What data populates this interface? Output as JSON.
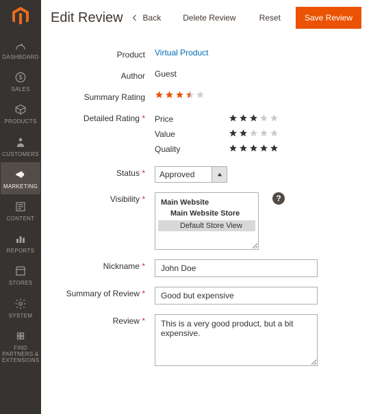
{
  "sidebar": {
    "items": [
      {
        "label": "DASHBOARD"
      },
      {
        "label": "SALES"
      },
      {
        "label": "PRODUCTS"
      },
      {
        "label": "CUSTOMERS"
      },
      {
        "label": "MARKETING"
      },
      {
        "label": "CONTENT"
      },
      {
        "label": "REPORTS"
      },
      {
        "label": "STORES"
      },
      {
        "label": "SYSTEM"
      },
      {
        "label": "FIND PARTNERS & EXTENSIONS"
      }
    ]
  },
  "header": {
    "title": "Edit Review",
    "back": "Back",
    "delete": "Delete Review",
    "reset": "Reset",
    "save": "Save Review"
  },
  "review": {
    "labels": {
      "product": "Product",
      "author": "Author",
      "summary_rating": "Summary Rating",
      "detailed_rating": "Detailed Rating",
      "status": "Status",
      "visibility": "Visibility",
      "nickname": "Nickname",
      "summary_of_review": "Summary of Review",
      "review": "Review"
    },
    "product_link": "Virtual Product",
    "author": "Guest",
    "summary_rating": {
      "value": 3.5,
      "max": 5
    },
    "detailed": [
      {
        "name": "Price",
        "value": 3,
        "max": 5
      },
      {
        "name": "Value",
        "value": 2,
        "max": 5
      },
      {
        "name": "Quality",
        "value": 5,
        "max": 5
      }
    ],
    "status": "Approved",
    "visibility": {
      "website": "Main Website",
      "store": "Main Website Store",
      "view": "Default Store View"
    },
    "nickname": "John Doe",
    "summary": "Good but expensive",
    "review_text": "This is a very good product, but a bit expensive."
  },
  "colors": {
    "accent": "#eb5202",
    "star_on": "#eb5202",
    "star_off": "#cccccc",
    "star_dark": "#333333"
  },
  "help_tooltip": "?"
}
